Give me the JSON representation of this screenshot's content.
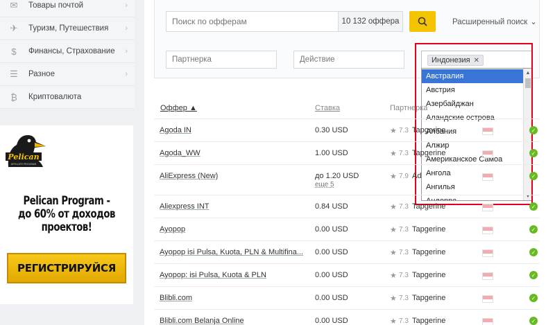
{
  "sidebar": {
    "items": [
      {
        "label": "Товары почтой",
        "icon": "mail-icon"
      },
      {
        "label": "Туризм, Путешествия",
        "icon": "plane-icon"
      },
      {
        "label": "Финансы, Страхование",
        "icon": "money-bag-icon"
      },
      {
        "label": "Разное",
        "icon": "list-icon"
      },
      {
        "label": "Криптовалюта",
        "icon": "bitcoin-icon"
      }
    ]
  },
  "banner": {
    "logo_text": "Pelican",
    "logo_subtext": "AFFILIATE PROGRAM",
    "title_line1": "Pelican Program -",
    "title_line2": "до 60% от доходов",
    "title_line3": "проектов!",
    "button_label": "РЕГИСТРИРУЙСЯ"
  },
  "search": {
    "placeholder": "Поиск по офферам",
    "count_label": "10 132 оффера",
    "advanced_label": "Расширенный поиск"
  },
  "filters": {
    "partner_placeholder": "Партнерка",
    "action_placeholder": "Действие",
    "country_tag": "Индонезия",
    "country_options": [
      "Австралия",
      "Австрия",
      "Азербайджан",
      "Аландские острова",
      "Албания",
      "Алжир",
      "Американское Самоа",
      "Ангола",
      "Ангилья",
      "Андорра"
    ],
    "selected_option_index": 0
  },
  "table": {
    "headers": {
      "offer": "Оффер ▲",
      "rate": "Ставка",
      "partner": "Партнерка"
    },
    "rows": [
      {
        "name": "Agoda IN",
        "rate": "0.30 USD",
        "rate_sub": "",
        "score": "7.3",
        "partner": "Tapgerine"
      },
      {
        "name": "Agoda_WW",
        "rate": "1.00 USD",
        "rate_sub": "",
        "score": "7.3",
        "partner": "Tapgerine"
      },
      {
        "name": "AliExpress (New)",
        "rate": "до 1.20 USD",
        "rate_sub": "еще 5",
        "score": "7.9",
        "partner": "Ad"
      },
      {
        "name": "Aliexpress INT",
        "rate": "0.84 USD",
        "rate_sub": "",
        "score": "7.3",
        "partner": "Tapgerine"
      },
      {
        "name": "Ayopop",
        "rate": "0.00 USD",
        "rate_sub": "",
        "score": "7.3",
        "partner": "Tapgerine"
      },
      {
        "name": "Ayopop isi Pulsa, Kuota, PLN & Multifina...",
        "rate": "0.00 USD",
        "rate_sub": "",
        "score": "7.3",
        "partner": "Tapgerine"
      },
      {
        "name": "Ayopop: isi Pulsa, Kuota & PLN",
        "rate": "0.00 USD",
        "rate_sub": "",
        "score": "7.3",
        "partner": "Tapgerine"
      },
      {
        "name": "Blibli.com",
        "rate": "0.00 USD",
        "rate_sub": "",
        "score": "7.3",
        "partner": "Tapgerine"
      },
      {
        "name": "Blibli.com Belanja Online",
        "rate": "0.00 USD",
        "rate_sub": "",
        "score": "7.3",
        "partner": "Tapgerine"
      }
    ]
  },
  "colors": {
    "accent": "#f5c400",
    "highlight": "#e4001b",
    "selection": "#3875d7",
    "status_ok": "#66bb22"
  }
}
